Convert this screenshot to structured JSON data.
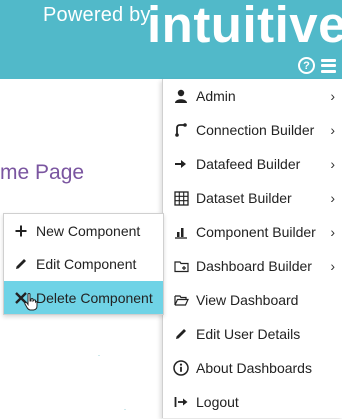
{
  "header": {
    "powered_by": "Powered by",
    "logo_text": "intuitive"
  },
  "page": {
    "title_fragment": "me Page"
  },
  "menu": {
    "items": [
      {
        "label": "Admin",
        "icon": "user-icon",
        "has_submenu": true
      },
      {
        "label": "Connection Builder",
        "icon": "connection-icon",
        "has_submenu": true
      },
      {
        "label": "Datafeed Builder",
        "icon": "arrow-right-icon",
        "has_submenu": true
      },
      {
        "label": "Dataset Builder",
        "icon": "grid-icon",
        "has_submenu": true
      },
      {
        "label": "Component Builder",
        "icon": "bar-chart-icon",
        "has_submenu": true
      },
      {
        "label": "Dashboard Builder",
        "icon": "folder-plus-icon",
        "has_submenu": true
      },
      {
        "label": "View Dashboard",
        "icon": "folder-open-icon",
        "has_submenu": false
      },
      {
        "label": "Edit User Details",
        "icon": "pencil-icon",
        "has_submenu": false
      },
      {
        "label": "About Dashboards",
        "icon": "info-icon",
        "has_submenu": false
      },
      {
        "label": "Logout",
        "icon": "logout-icon",
        "has_submenu": false
      }
    ],
    "chevron": "›"
  },
  "submenu": {
    "items": [
      {
        "label": "New Component",
        "icon": "plus-icon"
      },
      {
        "label": "Edit Component",
        "icon": "pencil-icon"
      },
      {
        "label": "Delete Component",
        "icon": "close-icon",
        "active": true
      }
    ]
  },
  "colors": {
    "header": "#51b9c9",
    "title": "#7a55a0",
    "active_item": "#6fd3e6"
  }
}
